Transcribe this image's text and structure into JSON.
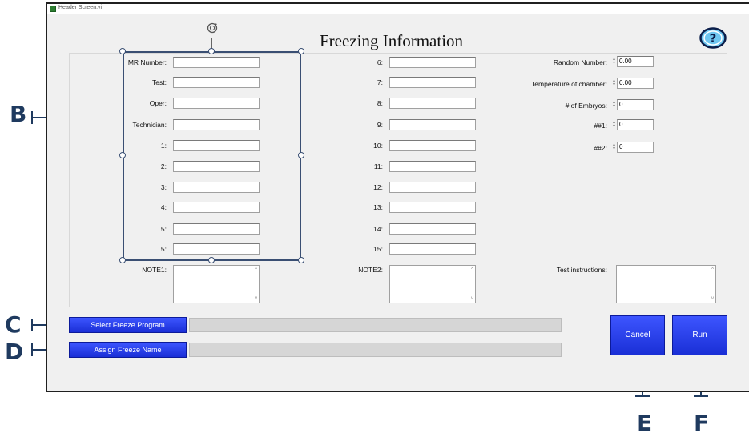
{
  "window": {
    "title": "Header Screen.vi"
  },
  "header": {
    "title": "Freezing Information"
  },
  "left_fields": [
    {
      "label": "MR Number:",
      "value": ""
    },
    {
      "label": "Test:",
      "value": ""
    },
    {
      "label": "Oper:",
      "value": ""
    },
    {
      "label": "Technician:",
      "value": ""
    },
    {
      "label": "1:",
      "value": ""
    },
    {
      "label": "2:",
      "value": ""
    },
    {
      "label": "3:",
      "value": ""
    },
    {
      "label": "4:",
      "value": ""
    },
    {
      "label": "5:",
      "value": ""
    },
    {
      "label": "5:",
      "value": ""
    }
  ],
  "middle_fields": [
    {
      "label": "6:",
      "value": ""
    },
    {
      "label": "7:",
      "value": ""
    },
    {
      "label": "8:",
      "value": ""
    },
    {
      "label": "9:",
      "value": ""
    },
    {
      "label": "10:",
      "value": ""
    },
    {
      "label": "11:",
      "value": ""
    },
    {
      "label": "12:",
      "value": ""
    },
    {
      "label": "13:",
      "value": ""
    },
    {
      "label": "14:",
      "value": ""
    },
    {
      "label": "15:",
      "value": ""
    }
  ],
  "numeric_fields": [
    {
      "label": "Random Number:",
      "value": "0.00"
    },
    {
      "label": "Temperature of chamber:",
      "value": "0.00"
    },
    {
      "label": "# of Embryos:",
      "value": "0"
    },
    {
      "label": "##1:",
      "value": "0"
    },
    {
      "label": "##2:",
      "value": "0"
    }
  ],
  "notes": {
    "note1_label": "NOTE1:",
    "note2_label": "NOTE2:",
    "instructions_label": "Test instructions:"
  },
  "buttons": {
    "select_program": "Select Freeze Program",
    "assign_name": "Assign Freeze Name",
    "cancel": "Cancel",
    "run": "Run"
  },
  "callouts": [
    "B",
    "C",
    "D",
    "E",
    "F"
  ],
  "colors": {
    "button_blue": "#2a3ff0",
    "annotation": "#1f3a5f",
    "selection": "#3a4f73"
  }
}
